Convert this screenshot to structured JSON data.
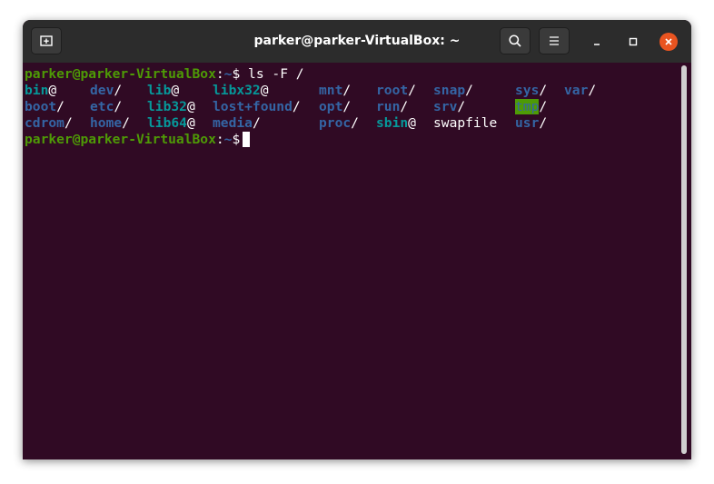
{
  "window": {
    "title": "parker@parker-VirtualBox: ~"
  },
  "icons": {
    "new_tab": "new-tab-icon",
    "search": "search-icon",
    "menu": "hamburger-menu-icon",
    "minimize": "minimize-icon",
    "maximize": "maximize-icon",
    "close": "close-icon"
  },
  "colors": {
    "terminal_bg": "#300a24",
    "titlebar_bg": "#2c2c2c",
    "prompt_user": "#4e9a06",
    "prompt_path": "#3465a4",
    "dir": "#3465a4",
    "symlink": "#06989a",
    "close_button": "#e95420"
  },
  "terminal": {
    "prompt1": {
      "user_host": "parker@parker-VirtualBox",
      "colon": ":",
      "path": "~",
      "dollar": "$ ",
      "command": "ls -F /"
    },
    "listing": {
      "row1": {
        "c1": "bin",
        "c1s": "@",
        "c2": "dev",
        "c2s": "/",
        "c3": "lib",
        "c3s": "@",
        "c4": "libx32",
        "c4s": "@",
        "c5": "mnt",
        "c5s": "/",
        "c6": "root",
        "c6s": "/",
        "c7": "snap",
        "c7s": "/",
        "c8": "sys",
        "c8s": "/",
        "c9": "var",
        "c9s": "/"
      },
      "row2": {
        "c1": "boot",
        "c1s": "/",
        "c2": "etc",
        "c2s": "/",
        "c3": "lib32",
        "c3s": "@",
        "c4": "lost+found",
        "c4s": "/",
        "c5": "opt",
        "c5s": "/",
        "c6": "run",
        "c6s": "/",
        "c7": "srv",
        "c7s": "/",
        "c8": "tmp",
        "c8s": "/"
      },
      "row3": {
        "c1": "cdrom",
        "c1s": "/",
        "c2": "home",
        "c2s": "/",
        "c3": "lib64",
        "c3s": "@",
        "c4": "media",
        "c4s": "/",
        "c5": "proc",
        "c5s": "/",
        "c6": "sbin",
        "c6s": "@",
        "c7": "swapfile",
        "c7s": "",
        "c8": "usr",
        "c8s": "/"
      }
    },
    "prompt2": {
      "user_host": "parker@parker-VirtualBox",
      "colon": ":",
      "path": "~",
      "dollar": "$"
    }
  }
}
